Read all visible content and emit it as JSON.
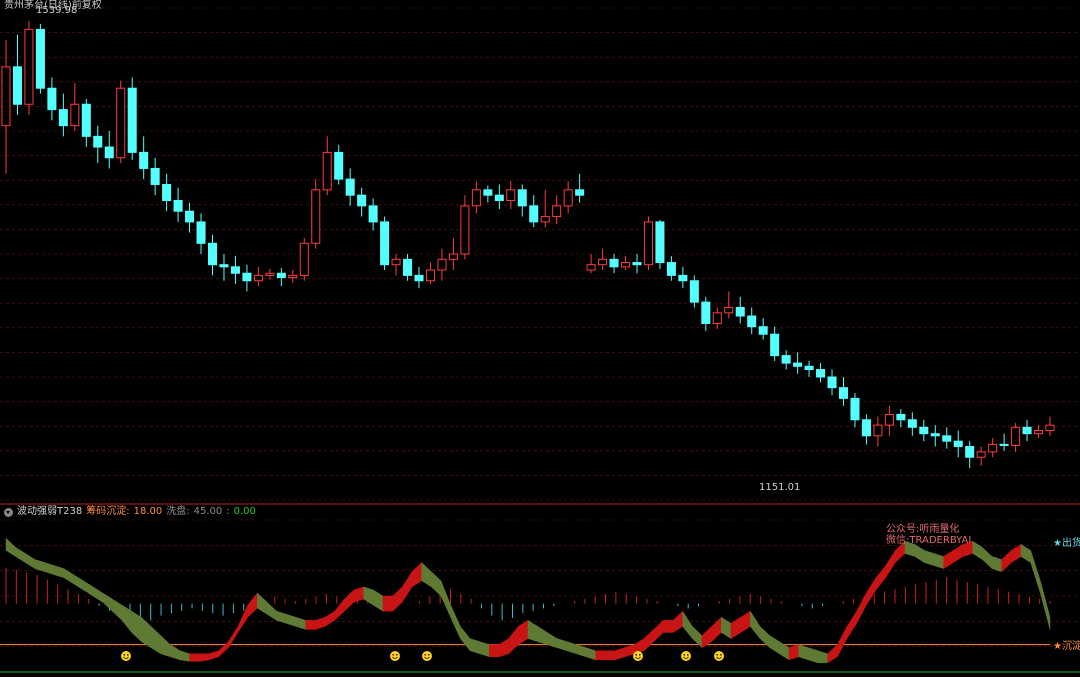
{
  "title": "贵州茅台(日线)前复权",
  "chart_data": [
    {
      "type": "candlestick",
      "price_range": [
        1100,
        1560
      ],
      "high_label": "1539.98",
      "low_label": "1151.01",
      "colors": {
        "up": "#ff3b3b",
        "down": "#54ffff",
        "grid": "#6b1414"
      },
      "candles": [
        [
          1450,
          1505,
          1405,
          1530
        ],
        [
          1505,
          1470,
          1460,
          1535
        ],
        [
          1470,
          1540,
          1460,
          1548
        ],
        [
          1540,
          1485,
          1480,
          1545
        ],
        [
          1485,
          1465,
          1455,
          1495
        ],
        [
          1465,
          1450,
          1440,
          1480
        ],
        [
          1450,
          1470,
          1445,
          1490
        ],
        [
          1470,
          1440,
          1430,
          1475
        ],
        [
          1440,
          1430,
          1415,
          1450
        ],
        [
          1430,
          1420,
          1410,
          1445
        ],
        [
          1420,
          1485,
          1415,
          1492
        ],
        [
          1485,
          1425,
          1418,
          1495
        ],
        [
          1425,
          1410,
          1400,
          1440
        ],
        [
          1410,
          1395,
          1385,
          1420
        ],
        [
          1395,
          1380,
          1370,
          1405
        ],
        [
          1380,
          1370,
          1360,
          1392
        ],
        [
          1370,
          1360,
          1350,
          1378
        ],
        [
          1360,
          1340,
          1330,
          1368
        ],
        [
          1340,
          1320,
          1310,
          1348
        ],
        [
          1320,
          1318,
          1305,
          1330
        ],
        [
          1318,
          1312,
          1302,
          1328
        ],
        [
          1312,
          1305,
          1295,
          1320
        ],
        [
          1305,
          1310,
          1300,
          1318
        ],
        [
          1310,
          1312,
          1306,
          1316
        ],
        [
          1312,
          1308,
          1300,
          1317
        ],
        [
          1308,
          1310,
          1303,
          1315
        ],
        [
          1310,
          1340,
          1305,
          1345
        ],
        [
          1340,
          1390,
          1335,
          1400
        ],
        [
          1390,
          1425,
          1385,
          1440
        ],
        [
          1425,
          1400,
          1395,
          1432
        ],
        [
          1400,
          1385,
          1375,
          1410
        ],
        [
          1385,
          1375,
          1365,
          1392
        ],
        [
          1375,
          1360,
          1352,
          1382
        ],
        [
          1360,
          1320,
          1315,
          1365
        ],
        [
          1320,
          1325,
          1310,
          1330
        ],
        [
          1325,
          1310,
          1305,
          1330
        ],
        [
          1310,
          1305,
          1298,
          1318
        ],
        [
          1305,
          1315,
          1302,
          1322
        ],
        [
          1315,
          1325,
          1305,
          1335
        ],
        [
          1325,
          1330,
          1315,
          1345
        ],
        [
          1330,
          1375,
          1325,
          1385
        ],
        [
          1375,
          1390,
          1368,
          1398
        ],
        [
          1390,
          1385,
          1378,
          1394
        ],
        [
          1385,
          1380,
          1372,
          1395
        ],
        [
          1380,
          1390,
          1372,
          1398
        ],
        [
          1390,
          1375,
          1365,
          1395
        ],
        [
          1375,
          1360,
          1355,
          1385
        ],
        [
          1360,
          1365,
          1355,
          1390
        ],
        [
          1365,
          1375,
          1358,
          1385
        ],
        [
          1375,
          1390,
          1368,
          1398
        ],
        [
          1390,
          1385,
          1378,
          1405
        ],
        [
          1315,
          1320,
          1312,
          1330
        ],
        [
          1320,
          1325,
          1315,
          1335
        ],
        [
          1325,
          1318,
          1312,
          1330
        ],
        [
          1318,
          1322,
          1315,
          1328
        ],
        [
          1322,
          1320,
          1312,
          1330
        ],
        [
          1320,
          1360,
          1315,
          1365
        ],
        [
          1360,
          1322,
          1316,
          1362
        ],
        [
          1322,
          1310,
          1305,
          1328
        ],
        [
          1310,
          1305,
          1298,
          1318
        ],
        [
          1305,
          1285,
          1280,
          1310
        ],
        [
          1285,
          1265,
          1258,
          1290
        ],
        [
          1265,
          1275,
          1260,
          1280
        ],
        [
          1275,
          1280,
          1270,
          1295
        ],
        [
          1280,
          1272,
          1265,
          1290
        ],
        [
          1272,
          1262,
          1255,
          1280
        ],
        [
          1262,
          1255,
          1250,
          1270
        ],
        [
          1255,
          1235,
          1230,
          1262
        ],
        [
          1235,
          1228,
          1222,
          1240
        ],
        [
          1228,
          1225,
          1218,
          1238
        ],
        [
          1225,
          1222,
          1215,
          1230
        ],
        [
          1222,
          1215,
          1210,
          1228
        ],
        [
          1215,
          1205,
          1198,
          1222
        ],
        [
          1205,
          1195,
          1188,
          1215
        ],
        [
          1195,
          1175,
          1168,
          1200
        ],
        [
          1175,
          1160,
          1152,
          1180
        ],
        [
          1160,
          1170,
          1150,
          1178
        ],
        [
          1170,
          1180,
          1160,
          1188
        ],
        [
          1180,
          1175,
          1168,
          1185
        ],
        [
          1175,
          1168,
          1160,
          1182
        ],
        [
          1168,
          1162,
          1155,
          1175
        ],
        [
          1162,
          1160,
          1150,
          1170
        ],
        [
          1160,
          1155,
          1148,
          1168
        ],
        [
          1155,
          1150,
          1140,
          1165
        ],
        [
          1150,
          1140,
          1130,
          1155
        ],
        [
          1140,
          1145,
          1132,
          1150
        ],
        [
          1145,
          1152,
          1140,
          1158
        ],
        [
          1152,
          1151,
          1146,
          1162
        ],
        [
          1151,
          1168,
          1145,
          1172
        ],
        [
          1168,
          1162,
          1155,
          1175
        ],
        [
          1162,
          1165,
          1158,
          1170
        ],
        [
          1165,
          1170,
          1160,
          1178
        ]
      ]
    },
    {
      "type": "area",
      "name": "波动强弱T238",
      "params": [
        {
          "label": "波动强弱T238",
          "color": "#d0d0d0"
        },
        {
          "label": "筹码沉淀:",
          "color": "#ff8c3a"
        },
        {
          "label": "18.00",
          "color": "#ff8c3a"
        },
        {
          "label": "洗盘:",
          "color": "#8c8c8c"
        },
        {
          "label": "45.00",
          "color": "#8c8c8c"
        },
        {
          "label": ":",
          "color": "#8c8c8c"
        },
        {
          "label": "0.00",
          "color": "#22cc22"
        }
      ],
      "levels": {
        "top_label": "★出货",
        "sink_label": "★沉淀",
        "sink_value": 18
      },
      "annotations": [
        "公众号:听雨量化",
        "微信:TRADERBYAI"
      ],
      "band_upper": [
        88,
        82,
        78,
        74,
        72,
        70,
        68,
        64,
        60,
        56,
        52,
        48,
        44,
        40,
        36,
        30,
        24,
        18,
        14,
        12,
        12,
        12,
        14,
        20,
        30,
        44,
        52,
        46,
        40,
        38,
        36,
        34,
        34,
        36,
        40,
        48,
        54,
        56,
        54,
        50,
        50,
        56,
        66,
        72,
        66,
        60,
        44,
        30,
        22,
        20,
        18,
        18,
        22,
        30,
        34,
        30,
        26,
        22,
        20,
        18,
        16,
        14,
        14,
        14,
        16,
        18,
        22,
        28,
        34,
        34,
        40,
        30,
        24,
        30,
        36,
        32,
        36,
        40,
        30,
        24,
        20,
        16,
        18,
        16,
        14,
        12,
        18,
        30,
        40,
        52,
        62,
        70,
        80,
        86,
        84,
        80,
        78,
        76,
        80,
        84,
        86,
        82,
        76,
        74,
        80,
        84,
        80,
        60,
        36
      ],
      "band_lower": [
        80,
        76,
        72,
        68,
        66,
        64,
        62,
        58,
        54,
        50,
        46,
        40,
        34,
        26,
        20,
        16,
        12,
        10,
        8,
        7,
        7,
        8,
        10,
        16,
        26,
        36,
        42,
        38,
        34,
        32,
        30,
        28,
        28,
        30,
        34,
        40,
        46,
        48,
        44,
        40,
        40,
        46,
        56,
        60,
        56,
        50,
        36,
        22,
        14,
        12,
        10,
        10,
        12,
        18,
        22,
        20,
        18,
        16,
        14,
        12,
        10,
        8,
        8,
        8,
        10,
        12,
        14,
        20,
        26,
        26,
        30,
        22,
        16,
        20,
        26,
        22,
        26,
        30,
        22,
        16,
        12,
        8,
        10,
        8,
        6,
        6,
        10,
        22,
        32,
        44,
        54,
        62,
        72,
        78,
        76,
        72,
        70,
        68,
        72,
        76,
        78,
        74,
        68,
        66,
        72,
        76,
        72,
        52,
        28
      ],
      "histogram": [
        30,
        28,
        26,
        24,
        20,
        16,
        12,
        8,
        4,
        -2,
        -6,
        -10,
        -14,
        -16,
        -14,
        -10,
        -8,
        -6,
        -4,
        -6,
        -8,
        -10,
        -8,
        -6,
        -4,
        2,
        6,
        4,
        2,
        4,
        6,
        8,
        6,
        4,
        6,
        10,
        8,
        4,
        2,
        0,
        2,
        6,
        10,
        12,
        8,
        4,
        -4,
        -10,
        -14,
        -12,
        -8,
        -6,
        -4,
        -2,
        0,
        2,
        4,
        6,
        8,
        10,
        8,
        6,
        4,
        2,
        0,
        -2,
        -4,
        -2,
        0,
        2,
        4,
        6,
        8,
        6,
        4,
        2,
        0,
        -2,
        -4,
        -2,
        0,
        2,
        4,
        6,
        8,
        10,
        12,
        14,
        16,
        18,
        20,
        22,
        20,
        18,
        16,
        14,
        12,
        10,
        8,
        6,
        4,
        2
      ],
      "smileys": [
        126,
        395,
        427,
        638,
        686,
        719
      ]
    }
  ]
}
